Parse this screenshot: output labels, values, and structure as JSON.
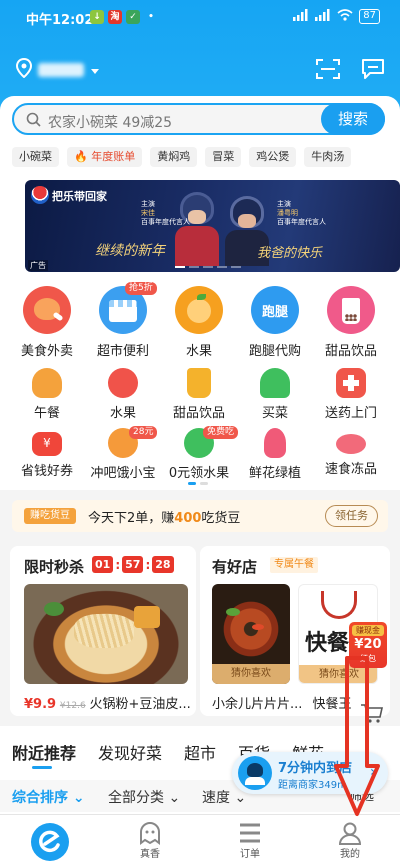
{
  "status_bar": {
    "time": "中午12:02",
    "battery": "87"
  },
  "header": {
    "location_label": "",
    "scan_icon": "scan-icon",
    "message_icon": "message-icon"
  },
  "search": {
    "placeholder": "农家小碗菜 49减25",
    "button": "搜索"
  },
  "hot_tags": [
    "小碗菜",
    "年度账单",
    "黄焖鸡",
    "冒菜",
    "鸡公煲",
    "牛肉汤"
  ],
  "banner": {
    "brand": "把乐带回家",
    "slogan1": "继续的新年",
    "slogan2": "我爸的快乐",
    "ad_label": "广告",
    "actor1_role": "主演",
    "actor1_name": "宋佳",
    "actor1_title": "百事年度代言人",
    "actor2_role": "主演",
    "actor2_name": "潘粤明",
    "actor2_title": "百事年度代言人"
  },
  "main_categories": [
    {
      "label": "美食外卖",
      "color": "#f0574a"
    },
    {
      "label": "超市便利",
      "color": "#3b9ff0",
      "badge": "抢5折"
    },
    {
      "label": "水果",
      "color": "#f6a01f"
    },
    {
      "label": "跑腿代购",
      "color": "#2e9bf0",
      "icon_text": "跑腿"
    },
    {
      "label": "甜品饮品",
      "color": "#f05a8a"
    }
  ],
  "sub_categories_row1": [
    {
      "label": "午餐",
      "color": "#f4a23c"
    },
    {
      "label": "水果",
      "color": "#f0534a"
    },
    {
      "label": "甜品饮品",
      "color": "#f4b22c"
    },
    {
      "label": "买菜",
      "color": "#3fbf5e"
    },
    {
      "label": "送药上门",
      "color": "#f0564a"
    }
  ],
  "sub_categories_row2": [
    {
      "label": "省钱好券",
      "color": "#f0463a"
    },
    {
      "label": "冲吧饿小宝",
      "color": "#f59a3a",
      "badge": "28元"
    },
    {
      "label": "0元领水果",
      "color": "#3fbf5e",
      "badge": "免费吃"
    },
    {
      "label": "鲜花绿植",
      "color": "#f05a78"
    },
    {
      "label": "速食冻品",
      "color": "#f26a7a"
    }
  ],
  "promo": {
    "tag": "赚吃货豆",
    "text_prefix": "今天下2单，赚",
    "amount": "400",
    "text_suffix": "吃货豆",
    "button": "领任务"
  },
  "flash_sale": {
    "title": "限时秒杀",
    "timer": [
      "01",
      "57",
      "28"
    ],
    "price": "¥9.9",
    "original_price": "¥12.6",
    "item": "火锅粉+豆油皮..."
  },
  "good_stores": {
    "title": "有好店",
    "tag": "专属午餐",
    "store1_tag": "猜你喜欢",
    "store1_name": "小余儿片片片...",
    "store2_tag": "猜你喜欢",
    "store2_name": "快餐王",
    "store2_logo_text": "快餐",
    "red_packet_label": "红包",
    "red_packet_text": "赚现金",
    "red_packet_amount": "¥20"
  },
  "content_tabs": [
    "附近推荐",
    "发现好菜",
    "超市",
    "百货",
    "鲜花"
  ],
  "sort_bar": [
    "综合排序",
    "全部分类",
    "速度",
    "筛选"
  ],
  "floating": {
    "title": "7分钟内到店",
    "subtitle": "距离商家349m"
  },
  "bottom_nav": [
    {
      "label": ""
    },
    {
      "label": "真香"
    },
    {
      "label": "订单"
    },
    {
      "label": "我的"
    }
  ],
  "colors": {
    "brand_blue": "#1a9ff0",
    "timer_red": "#e8362a",
    "price_red": "#e8362a",
    "annotation_red": "#e53323"
  }
}
